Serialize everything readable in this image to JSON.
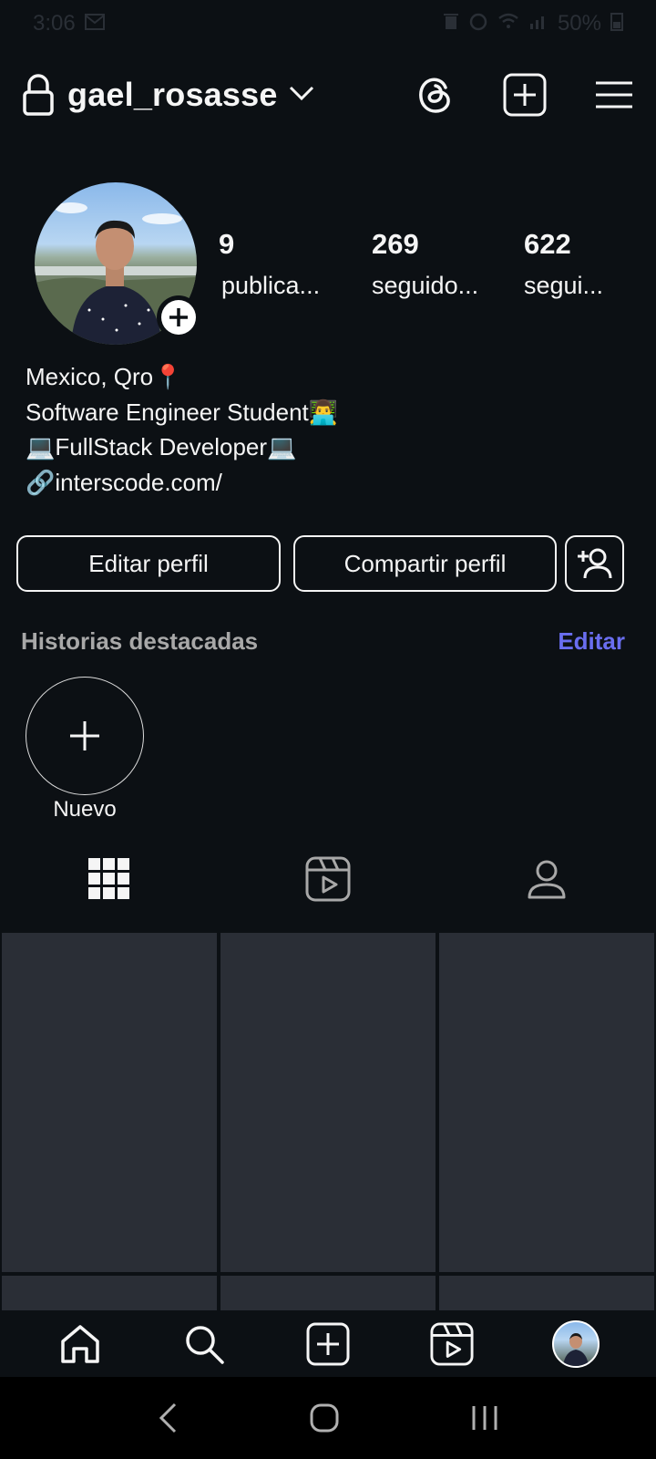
{
  "status_bar": {
    "time": "3:06",
    "battery": "50%"
  },
  "header": {
    "username": "gael_rosasse"
  },
  "stats": [
    {
      "value": "9",
      "label": "publica..."
    },
    {
      "value": "269",
      "label": "seguido..."
    },
    {
      "value": "622",
      "label": "segui..."
    }
  ],
  "bio": {
    "line1": "Mexico, Qro📍",
    "line2": "Software Engineer Student👨‍💻",
    "line3": "💻FullStack Developer💻",
    "line4": "🔗interscode.com/"
  },
  "buttons": {
    "edit_profile": "Editar perfil",
    "share_profile": "Compartir perfil"
  },
  "highlights": {
    "title": "Historias destacadas",
    "edit": "Editar",
    "new_label": "Nuevo"
  },
  "tabs": [
    "grid-icon",
    "reels-icon",
    "tagged-icon"
  ],
  "colors": {
    "background": "#0c1014",
    "accent": "#6a6ef0",
    "grid_tile": "#2a2e36"
  }
}
